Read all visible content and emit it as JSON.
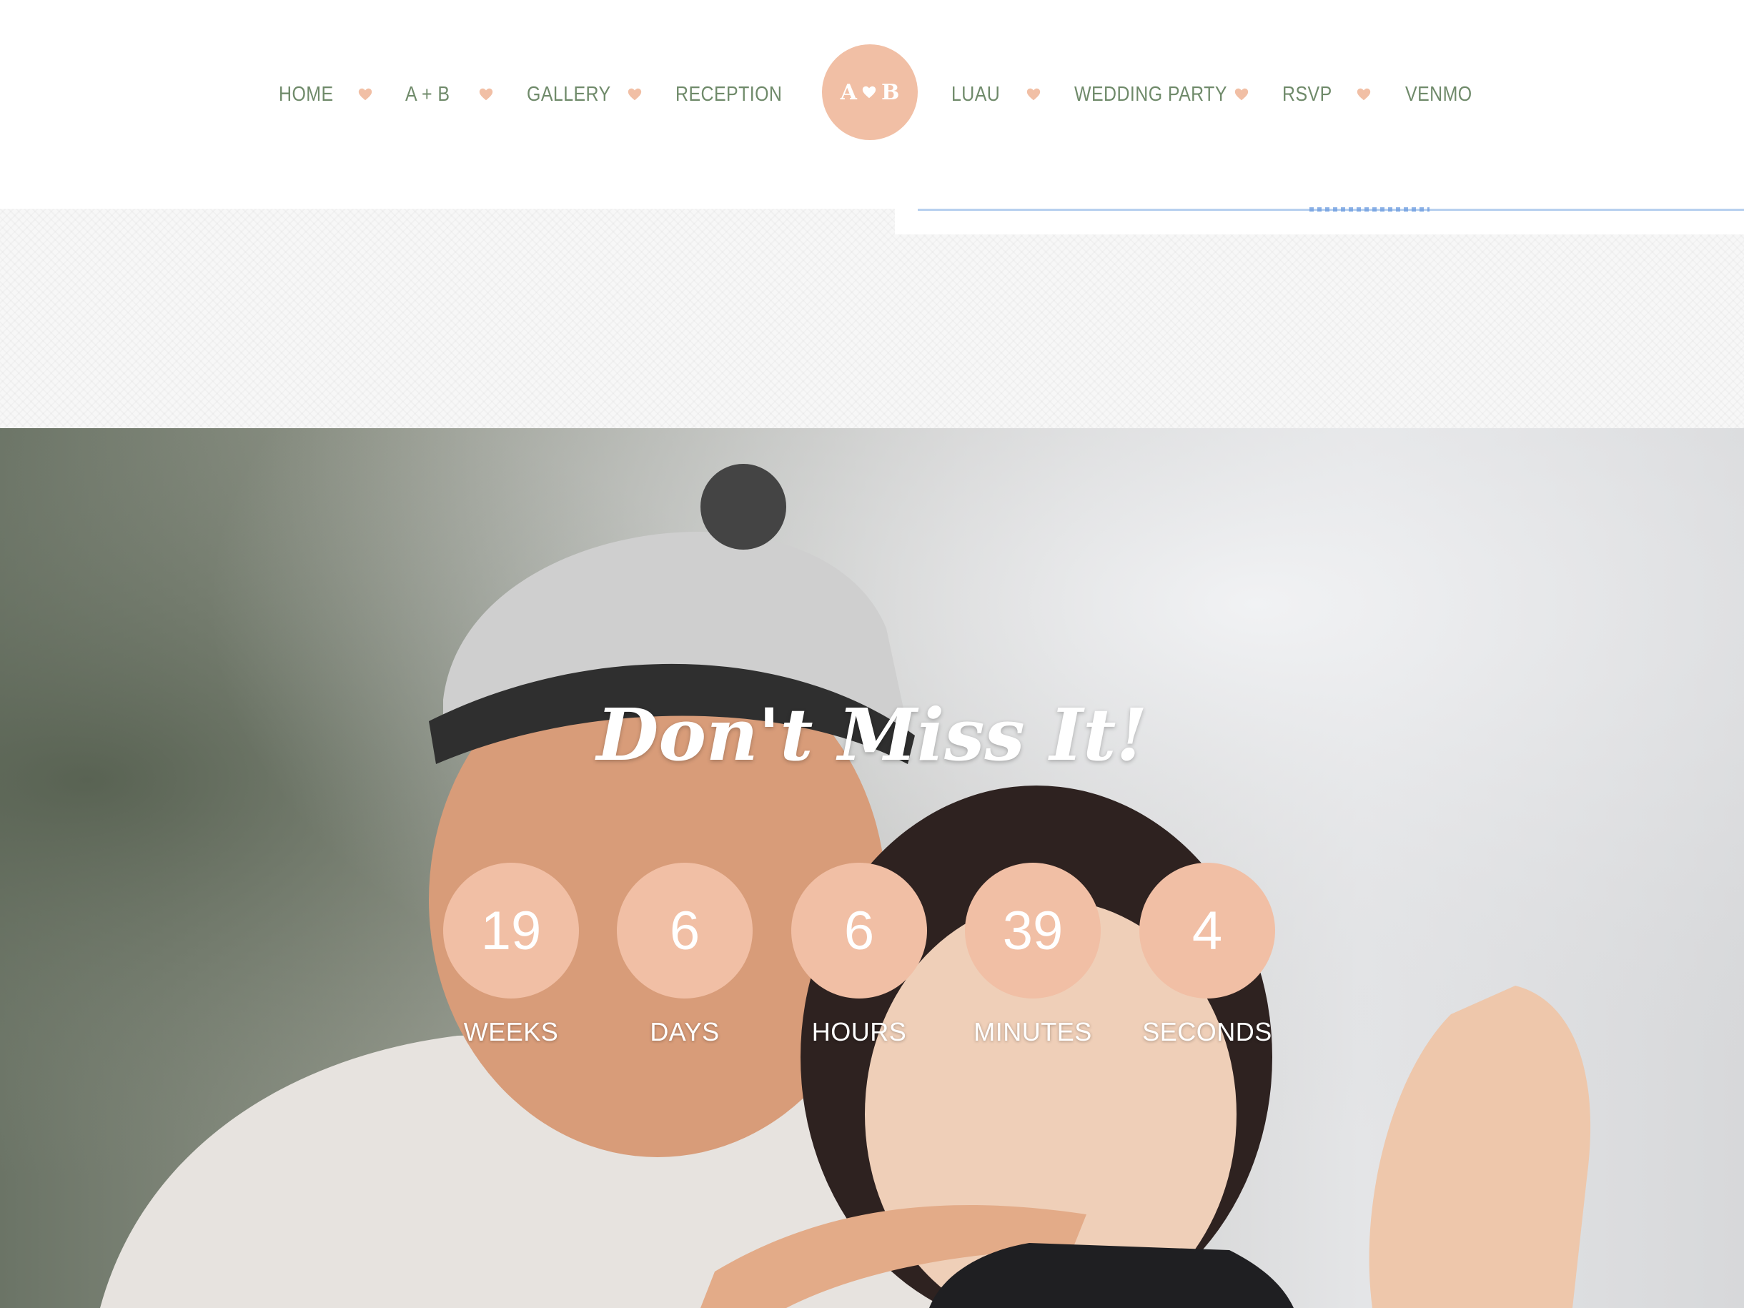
{
  "nav": {
    "left": [
      {
        "label": "HOME"
      },
      {
        "label": "A + B"
      },
      {
        "label": "GALLERY"
      },
      {
        "label": "RECEPTION"
      }
    ],
    "right": [
      {
        "label": "LUAU"
      },
      {
        "label": "WEDDING PARTY"
      },
      {
        "label": "RSVP"
      },
      {
        "label": "VENMO"
      }
    ],
    "separator_icon": "heart-icon"
  },
  "logo": {
    "left_letter": "A",
    "right_letter": "B",
    "icon": "heart-icon"
  },
  "hero": {
    "title": "Don't Miss It!",
    "countdown": [
      {
        "value": "19",
        "label": "WEEKS"
      },
      {
        "value": "6",
        "label": "DAYS"
      },
      {
        "value": "6",
        "label": "HOURS"
      },
      {
        "value": "39",
        "label": "MINUTES"
      },
      {
        "value": "4",
        "label": "SECONDS"
      }
    ]
  },
  "colors": {
    "nav_text": "#6f8a6a",
    "accent": "#f1bfa5",
    "background": "#ffffff"
  }
}
